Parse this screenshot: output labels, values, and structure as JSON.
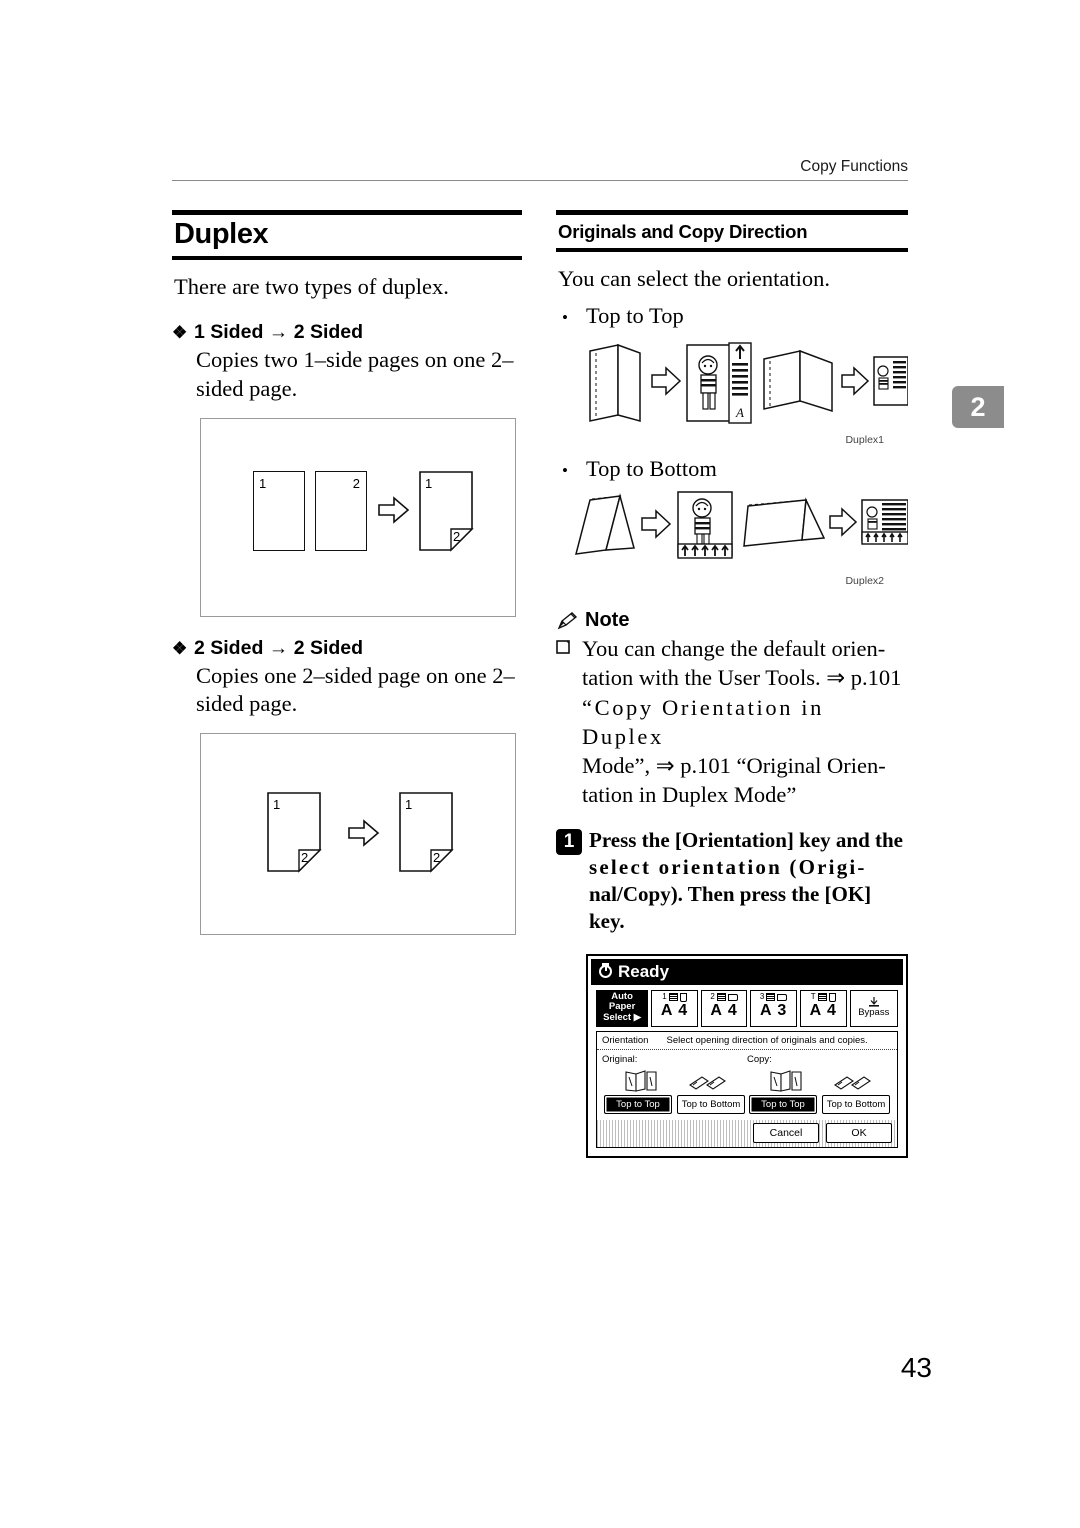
{
  "running_head": "Copy Functions",
  "chapter_tab": "2",
  "page_number": "43",
  "left_column": {
    "heading": "Duplex",
    "intro": "There are two types of duplex.",
    "sections": [
      {
        "bullet": "❖",
        "title": "1 Sided → 2 Sided",
        "body": "Copies two 1–side pages on one 2–sided page.",
        "figure": {
          "name": "one-sided-to-two-sided-diagram",
          "sheets": [
            {
              "label": "1",
              "position": "top-left"
            },
            {
              "label": "2",
              "position": "top-right"
            }
          ],
          "arrow": "⇒",
          "result_sheet": {
            "front_label": "1",
            "back_label": "2"
          }
        }
      },
      {
        "bullet": "❖",
        "title": "2 Sided → 2 Sided",
        "body": "Copies one 2–sided page on one 2–sided page.",
        "figure": {
          "name": "two-sided-to-two-sided-diagram",
          "source_sheet": {
            "front_label": "1",
            "back_label": "2"
          },
          "arrow": "⇒",
          "result_sheet": {
            "front_label": "1",
            "back_label": "2"
          }
        }
      }
    ]
  },
  "right_column": {
    "heading": "Originals and Copy Direction",
    "intro": "You can select the orientation.",
    "orientation_items": [
      {
        "bullet": "•",
        "label": "Top to Top",
        "figure_caption": "Duplex1"
      },
      {
        "bullet": "•",
        "label": "Top to Bottom",
        "figure_caption": "Duplex2"
      }
    ],
    "note": {
      "icon": "pencil-icon",
      "title": "Note",
      "box_glyph": "❑",
      "text_lines": [
        "You can change the default orien-",
        "tation with the User Tools. ⇒ p.101",
        "“Copy Orientation in Duplex",
        "Mode”, ⇒ p.101 “Original Orien-",
        "tation in Duplex Mode”"
      ],
      "text_full": "You can change the default orientation with the User Tools. ⇒ p.101 “Copy Orientation in Duplex Mode”, ⇒ p.101 “Original Orientation in Duplex Mode”"
    },
    "step": {
      "number": "1",
      "lines": [
        "Press the [Orientation] key and the",
        "select orientation (Origi-",
        "nal/Copy). Then press the [OK]",
        "key."
      ]
    }
  },
  "lcd_panel": {
    "name": "operation-panel-screenshot",
    "status_icon": "power-icon",
    "status_text": "Ready",
    "paper_trays": [
      {
        "id": "auto",
        "line1": "Auto Paper",
        "line2": "Select ▶",
        "selected": true
      },
      {
        "id": "tray1",
        "number": "1",
        "size": "A 4",
        "orientation": "portrait"
      },
      {
        "id": "tray2",
        "number": "2",
        "size": "A 4",
        "orientation": "landscape"
      },
      {
        "id": "tray3",
        "number": "3",
        "size": "A 3",
        "orientation": "landscape"
      },
      {
        "id": "trayT",
        "number": "T",
        "size": "A 4",
        "orientation": "portrait"
      },
      {
        "id": "bypass",
        "label": "Bypass"
      }
    ],
    "orientation_panel": {
      "title": "Orientation",
      "instruction": "Select opening direction of originals and copies.",
      "groups": [
        {
          "label": "Original:",
          "buttons": [
            {
              "label": "Top to Top",
              "selected": true
            },
            {
              "label": "Top to Bottom",
              "selected": false
            }
          ]
        },
        {
          "label": "Copy:",
          "buttons": [
            {
              "label": "Top to Top",
              "selected": true
            },
            {
              "label": "Top to Bottom",
              "selected": false
            }
          ]
        }
      ],
      "footer_buttons": [
        {
          "label": "Cancel"
        },
        {
          "label": "OK"
        }
      ]
    }
  }
}
